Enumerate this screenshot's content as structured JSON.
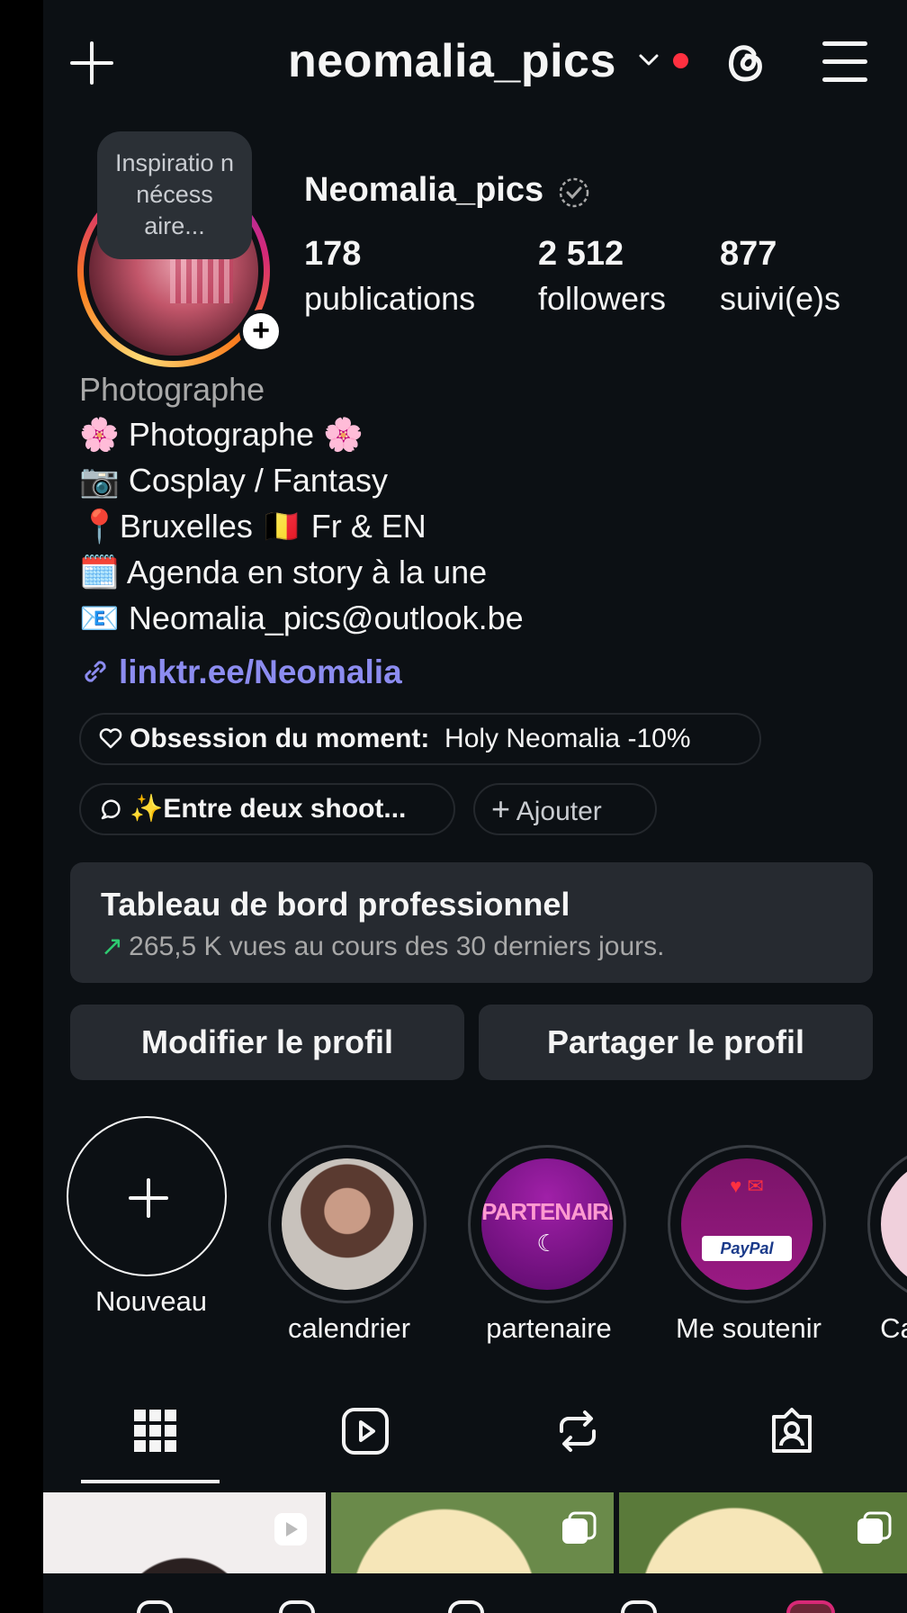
{
  "header": {
    "username": "neomalia_pics",
    "icons": [
      "plus-icon",
      "chevron-down-icon",
      "notification-dot",
      "threads-icon",
      "menu-icon"
    ],
    "accent_red": "#ff3040"
  },
  "profile": {
    "note": "Inspiratio n nécess aire...",
    "display_name": "Neomalia_pics",
    "stats": [
      {
        "value": "178",
        "label": "publications"
      },
      {
        "value": "2 512",
        "label": "followers"
      },
      {
        "value": "877",
        "label": "suivi(e)s"
      }
    ],
    "category": "Photographe",
    "bio": [
      "🌸 Photographe 🌸",
      "📷 Cosplay / Fantasy",
      "📍Bruxelles  🇧🇪 Fr & EN",
      "🗓️ Agenda en story à la une",
      "📧 Neomalia_pics@outlook.be"
    ],
    "link": "linktr.ee/Neomalia",
    "link_color": "#8c8cf0"
  },
  "chips": {
    "obsession_label": "Obsession du moment:",
    "obsession_value": "Holy Neomalia -10%",
    "thread": "✨Entre deux shoot...",
    "add": "Ajouter"
  },
  "dashboard": {
    "title": "Tableau de bord professionnel",
    "subtitle": "265,5 K vues au cours des 30 derniers jours.",
    "trend_color": "#2ecc71"
  },
  "actions": {
    "edit": "Modifier le profil",
    "share": "Partager le profil"
  },
  "highlights": [
    {
      "label": "Nouveau"
    },
    {
      "label": "calendrier"
    },
    {
      "label": "partenaire",
      "cover_text": "PARTENAIRE"
    },
    {
      "label": "Me soutenir",
      "cover_text": "PayPal"
    },
    {
      "label": "Ca"
    }
  ],
  "tabs": [
    "grid-icon",
    "reels-icon",
    "reposts-icon",
    "tagged-icon"
  ]
}
